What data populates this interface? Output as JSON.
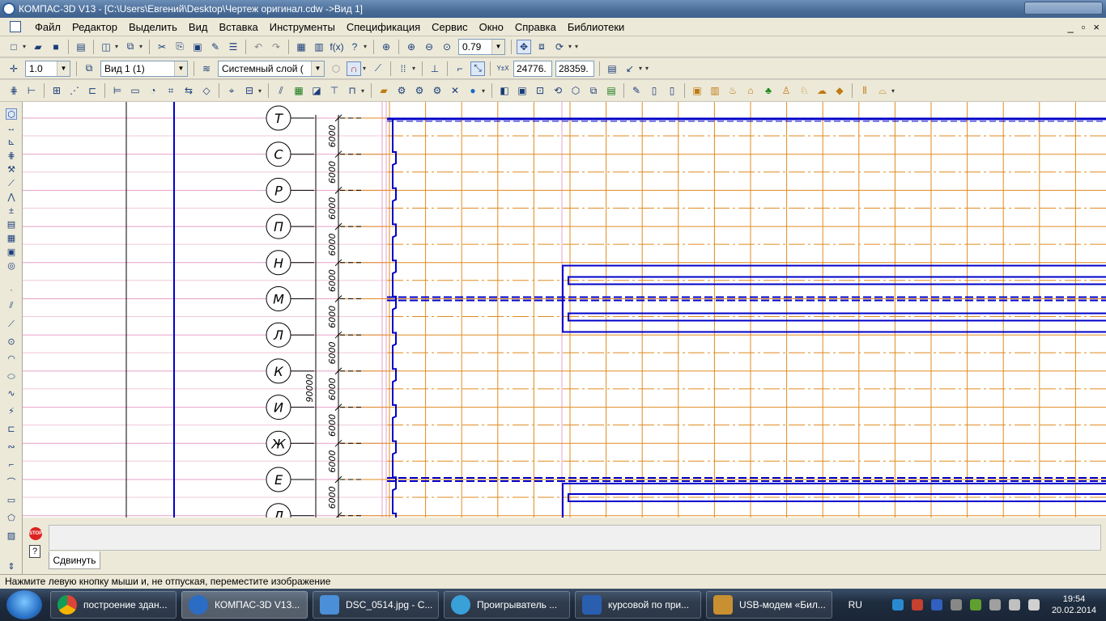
{
  "window": {
    "title": "КОМПАС-3D V13 - [C:\\Users\\Евгений\\Desktop\\Чертеж оригинал.cdw ->Вид 1]"
  },
  "menu": {
    "items": [
      "Файл",
      "Редактор",
      "Выделить",
      "Вид",
      "Вставка",
      "Инструменты",
      "Спецификация",
      "Сервис",
      "Окно",
      "Справка",
      "Библиотеки"
    ],
    "mdi": [
      "_",
      "▫",
      "×"
    ]
  },
  "toolbar1": {
    "zoom_value": "0.79"
  },
  "toolbar2": {
    "step_value": "1.0",
    "view_value": "Вид 1 (1)",
    "layer_value": "Системный слой (",
    "coord_x": "24776.",
    "coord_y": "28359.",
    "coord_label": "Y±X"
  },
  "drawing": {
    "axis_labels": [
      "Т",
      "С",
      "Р",
      "П",
      "Н",
      "М",
      "Л",
      "К",
      "И",
      "Ж",
      "Е",
      "Д"
    ],
    "dimension_value": "6000",
    "total_dimension": "90000"
  },
  "command": {
    "tab_label": "Сдвинуть",
    "stop_label": "STOP",
    "help_label": "?"
  },
  "status": {
    "message": "Нажмите левую кнопку мыши и, не отпуская, переместите изображение"
  },
  "taskbar": {
    "tasks": [
      {
        "label": "построение здан...",
        "color": "#e8c030"
      },
      {
        "label": "КОМПАС-3D V13...",
        "color": "#2b6cc4"
      },
      {
        "label": "DSC_0514.jpg - С...",
        "color": "#4a8fd8"
      },
      {
        "label": "Проигрыватель ...",
        "color": "#3aa0d8"
      },
      {
        "label": "курсовой по при...",
        "color": "#2a5fb0"
      },
      {
        "label": "USB-модем «Бил...",
        "color": "#c89030"
      }
    ],
    "language": "RU",
    "time": "19:54",
    "date": "20.02.2014"
  },
  "colors": {
    "grid_orange": "#e08a1e",
    "line_blue": "#0000c8",
    "pink_line": "#e6a0c8"
  }
}
